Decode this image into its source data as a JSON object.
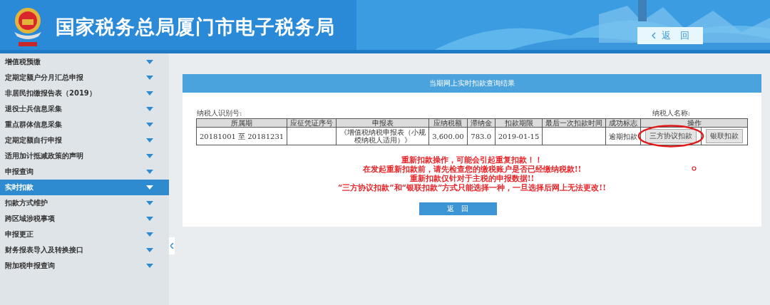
{
  "header": {
    "title": "国家税务总局厦门市电子税务局",
    "back_button": "返　回"
  },
  "sidebar": {
    "items": [
      {
        "label": "增值税预缴",
        "selected": false
      },
      {
        "label": "定期定额户分月汇总申报",
        "selected": false
      },
      {
        "label": "非居民扣缴报告表（2019）",
        "selected": false
      },
      {
        "label": "退役士兵信息采集",
        "selected": false
      },
      {
        "label": "重点群体信息采集",
        "selected": false
      },
      {
        "label": "定期定额自行申报",
        "selected": false
      },
      {
        "label": "适用加计抵减政策的声明",
        "selected": false
      },
      {
        "label": "申报查询",
        "selected": false
      },
      {
        "label": "实时扣款",
        "selected": true
      },
      {
        "label": "扣款方式维护",
        "selected": false
      },
      {
        "label": "跨区域涉税事项",
        "selected": false
      },
      {
        "label": "申报更正",
        "selected": false
      },
      {
        "label": "财务报表导入及转换接口",
        "selected": false
      },
      {
        "label": "附加税申报查询",
        "selected": false
      }
    ]
  },
  "panel": {
    "title": "当期网上实时扣款查询结果",
    "taxpayer_id_label": "纳税人识别号:",
    "taxpayer_name_label": "纳税人名称:",
    "table": {
      "columns": [
        "所属期",
        "应征凭证序号",
        "申报表",
        "应纳税额",
        "滞纳金",
        "扣款期限",
        "最后一次扣款时间",
        "成功标志",
        "操作"
      ],
      "rows": [
        {
          "cells": [
            "20181001 至 20181231",
            "",
            "《增值税纳税申报表（小规模纳税人适用）》",
            "3,600.00",
            "783.0",
            "2019-01-15",
            "",
            "逾期扣款"
          ],
          "actions": [
            "三方协议扣款",
            "银联扣款"
          ]
        }
      ]
    },
    "warnings": [
      "重新扣款操作，可能会引起重复扣款！！",
      "在发起重新扣款前，请先检查您的缴税账户是否已经缴纳税款!!",
      "重新扣款仅针对于主税的申报数据!!",
      "“三方协议扣款”和“银联扣款”方式只能选择一种，一旦选择后网上无法更改!!"
    ],
    "return_button": "返　回"
  }
}
